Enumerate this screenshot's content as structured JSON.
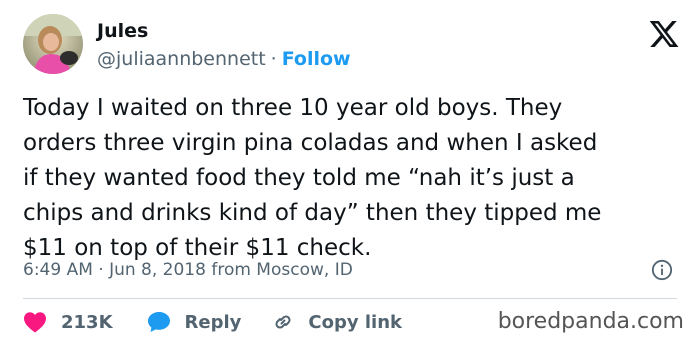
{
  "author": {
    "display_name": "Jules",
    "handle": "@juliaannbennett",
    "separator": "·",
    "follow_label": "Follow"
  },
  "tweet": {
    "text": "Today I waited on three 10 year old boys. They\norders three virgin pina coladas and when I asked\nif they wanted food they told me “nah it’s just a\nchips and drinks kind of day” then they tipped me\n$11 on top of their $11 check.",
    "meta": "6:49 AM · Jun 8, 2018 from Moscow, ID"
  },
  "actions": {
    "like_count": "213K",
    "reply_label": "Reply",
    "copy_link_label": "Copy link"
  },
  "watermark": "boredpanda.com",
  "colors": {
    "text": "#0f1419",
    "secondary": "#536471",
    "link": "#1d9bf0",
    "like": "#f91880",
    "reply": "#1d9bf0",
    "divider": "#cfd9de"
  },
  "icons": {
    "logo": "x-logo",
    "info": "info-icon",
    "like": "heart-icon",
    "reply": "speech-bubble-icon",
    "copy": "link-chain-icon"
  }
}
